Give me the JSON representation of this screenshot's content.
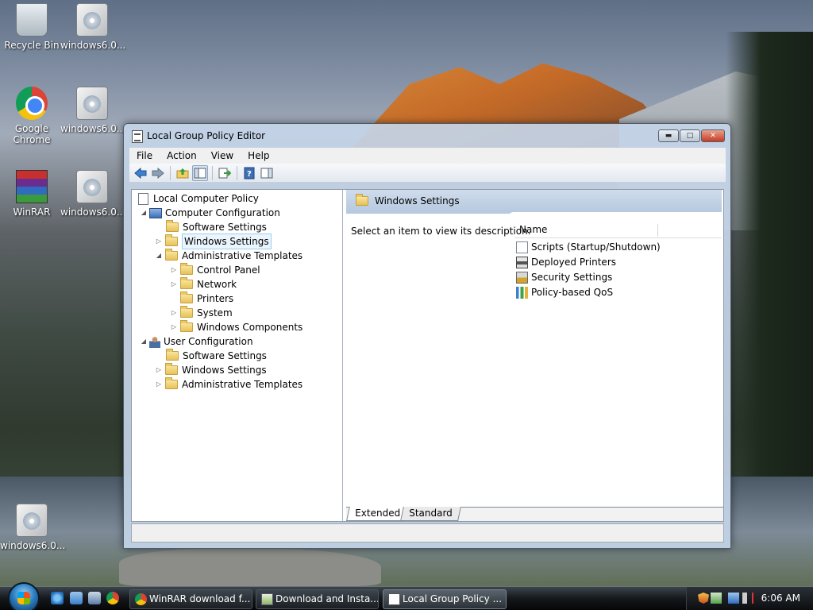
{
  "desktop": {
    "icons": [
      {
        "label": "Recycle Bin"
      },
      {
        "label": "windows6.0..."
      },
      {
        "label": "Google Chrome"
      },
      {
        "label": "windows6.0..."
      },
      {
        "label": "WinRAR"
      },
      {
        "label": "windows6.0..."
      },
      {
        "label": "windows6.0..."
      }
    ]
  },
  "window": {
    "title": "Local Group Policy Editor",
    "menu": [
      "File",
      "Action",
      "View",
      "Help"
    ],
    "tree": {
      "root": "Local Computer Policy",
      "computer_config": "Computer Configuration",
      "cc_software": "Software Settings",
      "cc_windows": "Windows Settings",
      "cc_admin": "Administrative Templates",
      "cc_admin_control_panel": "Control Panel",
      "cc_admin_network": "Network",
      "cc_admin_printers": "Printers",
      "cc_admin_system": "System",
      "cc_admin_windows_components": "Windows Components",
      "user_config": "User Configuration",
      "uc_software": "Software Settings",
      "uc_windows": "Windows Settings",
      "uc_admin": "Administrative Templates"
    },
    "right_pane": {
      "header_title": "Windows Settings",
      "description": "Select an item to view its description.",
      "column_name": "Name",
      "items": [
        {
          "label": "Scripts (Startup/Shutdown)",
          "icon": "script-icon"
        },
        {
          "label": "Deployed Printers",
          "icon": "printer-icon"
        },
        {
          "label": "Security Settings",
          "icon": "security-icon"
        },
        {
          "label": "Policy-based QoS",
          "icon": "qos-chart-icon"
        }
      ]
    },
    "tabs": [
      {
        "label": "Extended",
        "active": true
      },
      {
        "label": "Standard",
        "active": false
      }
    ]
  },
  "taskbar": {
    "buttons": [
      {
        "label": "WinRAR download f...",
        "active": false
      },
      {
        "label": "Download and Insta...",
        "active": false
      },
      {
        "label": "Local Group Policy ...",
        "active": true
      }
    ],
    "clock": "6:06 AM"
  }
}
